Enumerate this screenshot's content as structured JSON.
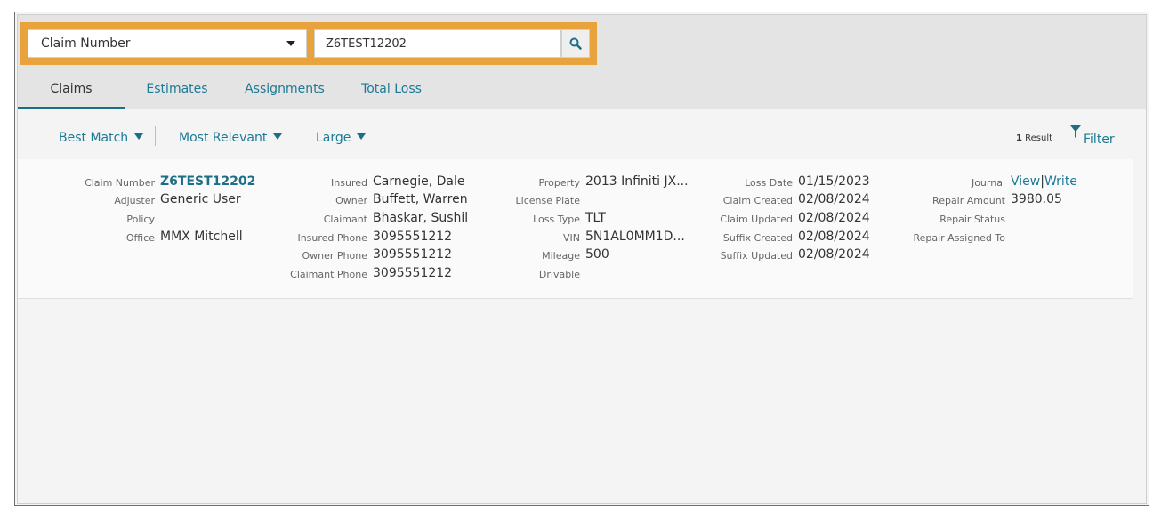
{
  "search": {
    "type_selected": "Claim Number",
    "query": "Z6TEST12202"
  },
  "tabs": [
    {
      "label": "Claims",
      "active": true
    },
    {
      "label": "Estimates",
      "active": false
    },
    {
      "label": "Assignments",
      "active": false
    },
    {
      "label": "Total Loss",
      "active": false
    }
  ],
  "sort": {
    "best_match": "Best Match",
    "most_relevant": "Most Relevant",
    "size": "Large"
  },
  "results": {
    "count": "1",
    "count_label": "Result",
    "filter_label": "Filter"
  },
  "claim": {
    "col1": {
      "claim_number_label": "Claim Number",
      "claim_number": "Z6TEST12202",
      "adjuster_label": "Adjuster",
      "adjuster": "Generic User",
      "policy_label": "Policy",
      "policy": "",
      "office_label": "Office",
      "office": "MMX Mitchell"
    },
    "col2": {
      "insured_label": "Insured",
      "insured": "Carnegie, Dale",
      "owner_label": "Owner",
      "owner": "Buffett, Warren",
      "claimant_label": "Claimant",
      "claimant": "Bhaskar, Sushil",
      "insured_phone_label": "Insured Phone",
      "insured_phone": "3095551212",
      "owner_phone_label": "Owner Phone",
      "owner_phone": "3095551212",
      "claimant_phone_label": "Claimant Phone",
      "claimant_phone": "3095551212"
    },
    "col3": {
      "property_label": "Property",
      "property": "2013 Infiniti JX...",
      "license_plate_label": "License Plate",
      "license_plate": "",
      "loss_type_label": "Loss Type",
      "loss_type": "TLT",
      "vin_label": "VIN",
      "vin": "5N1AL0MM1D...",
      "mileage_label": "Mileage",
      "mileage": "500",
      "drivable_label": "Drivable",
      "drivable": ""
    },
    "col4": {
      "loss_date_label": "Loss Date",
      "loss_date": "01/15/2023",
      "claim_created_label": "Claim Created",
      "claim_created": "02/08/2024",
      "claim_updated_label": "Claim Updated",
      "claim_updated": "02/08/2024",
      "suffix_created_label": "Suffix Created",
      "suffix_created": "02/08/2024",
      "suffix_updated_label": "Suffix Updated",
      "suffix_updated": "02/08/2024"
    },
    "col5": {
      "journal_label": "Journal",
      "journal_view": "View",
      "journal_sep": "|",
      "journal_write": "Write",
      "repair_amount_label": "Repair Amount",
      "repair_amount": "3980.05",
      "repair_status_label": "Repair Status",
      "repair_status": "",
      "repair_assigned_label": "Repair Assigned To",
      "repair_assigned": ""
    }
  },
  "icons": {
    "search": "search-icon",
    "filter": "filter-icon",
    "dropdown": "chevron-down-icon"
  },
  "colors": {
    "accent": "#1d7a95",
    "highlight": "#e8a33d"
  }
}
